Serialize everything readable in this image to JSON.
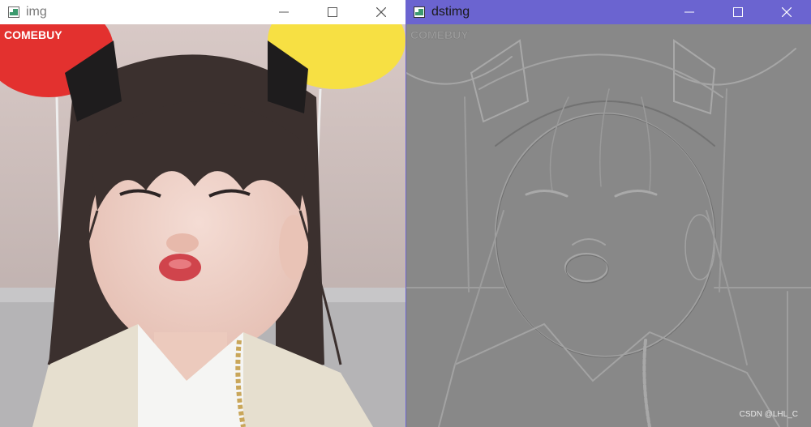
{
  "windows": [
    {
      "title": "img"
    },
    {
      "title": "dstimg"
    }
  ],
  "overlay": {
    "watermark": "CSDN @LHL_C"
  },
  "colors": {
    "active_titlebar": "#6b64d0",
    "inactive_titlebar": "#ffffff",
    "emboss_gray": "#8a8a8a"
  }
}
